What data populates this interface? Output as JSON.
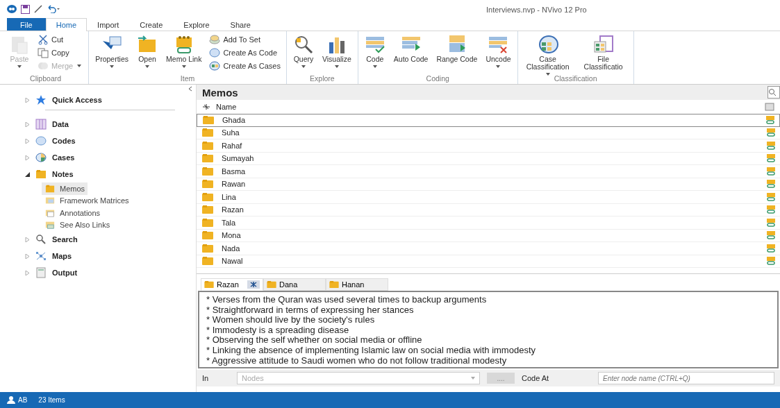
{
  "window": {
    "title": "Interviews.nvp - NVivo 12 Pro"
  },
  "ribbon_tabs": [
    {
      "label": "File",
      "kind": "file",
      "selected": false
    },
    {
      "label": "Home",
      "kind": "tab",
      "selected": true
    },
    {
      "label": "Import",
      "kind": "tab",
      "selected": false
    },
    {
      "label": "Create",
      "kind": "tab",
      "selected": false
    },
    {
      "label": "Explore",
      "kind": "tab",
      "selected": false
    },
    {
      "label": "Share",
      "kind": "tab",
      "selected": false
    }
  ],
  "ribbon_groups": [
    {
      "label": "Clipboard",
      "buttons": [
        {
          "label": "Paste",
          "kind": "large",
          "dropdown": true,
          "disabled": true
        },
        {
          "label": "Cut",
          "kind": "small",
          "dropdown": false,
          "disabled": false
        },
        {
          "label": "Copy",
          "kind": "small",
          "dropdown": false,
          "disabled": false
        },
        {
          "label": "Merge",
          "kind": "small",
          "dropdown": true,
          "disabled": true
        }
      ]
    },
    {
      "label": "Item",
      "buttons": [
        {
          "label": "Properties",
          "kind": "large",
          "dropdown": true,
          "disabled": false
        },
        {
          "label": "Open",
          "kind": "large",
          "dropdown": true,
          "disabled": false
        },
        {
          "label": "Memo Link",
          "kind": "large",
          "dropdown": true,
          "disabled": false
        },
        {
          "label": "Add To Set",
          "kind": "small",
          "dropdown": false,
          "disabled": false
        },
        {
          "label": "Create As Code",
          "kind": "small",
          "dropdown": false,
          "disabled": false
        },
        {
          "label": "Create As Cases",
          "kind": "small",
          "dropdown": false,
          "disabled": false
        }
      ]
    },
    {
      "label": "Explore",
      "buttons": [
        {
          "label": "Query",
          "kind": "large",
          "dropdown": true,
          "disabled": false
        },
        {
          "label": "Visualize",
          "kind": "large",
          "dropdown": true,
          "disabled": false
        }
      ]
    },
    {
      "label": "Coding",
      "buttons": [
        {
          "label": "Code",
          "kind": "large",
          "dropdown": true,
          "disabled": false
        },
        {
          "label": "Auto Code",
          "kind": "large",
          "dropdown": false,
          "disabled": false
        },
        {
          "label": "Range Code",
          "kind": "large",
          "dropdown": false,
          "disabled": false
        },
        {
          "label": "Uncode",
          "kind": "large",
          "dropdown": true,
          "disabled": false
        }
      ]
    },
    {
      "label": "Classification",
      "buttons": [
        {
          "label": "Case Classification",
          "kind": "large",
          "dropdown": true,
          "disabled": false
        },
        {
          "label": "File Classificatio",
          "kind": "large",
          "dropdown": false,
          "disabled": false
        }
      ]
    }
  ],
  "navigation": [
    {
      "label": "Quick Access",
      "expanded": false,
      "selected": false
    },
    {
      "label": "Data",
      "expanded": false,
      "selected": false
    },
    {
      "label": "Codes",
      "expanded": false,
      "selected": false
    },
    {
      "label": "Cases",
      "expanded": false,
      "selected": false
    },
    {
      "label": "Notes",
      "expanded": true,
      "selected": false,
      "children": [
        {
          "label": "Memos",
          "selected": true
        },
        {
          "label": "Framework Matrices",
          "selected": false
        },
        {
          "label": "Annotations",
          "selected": false
        },
        {
          "label": "See Also Links",
          "selected": false
        }
      ]
    },
    {
      "label": "Search",
      "expanded": false,
      "selected": false
    },
    {
      "label": "Maps",
      "expanded": false,
      "selected": false
    },
    {
      "label": "Output",
      "expanded": false,
      "selected": false
    }
  ],
  "list": {
    "title": "Memos",
    "columns": [
      "Name"
    ],
    "rows": [
      {
        "name": "Ghada",
        "selected": true
      },
      {
        "name": "Suha",
        "selected": false
      },
      {
        "name": "Rahaf",
        "selected": false
      },
      {
        "name": "Sumayah",
        "selected": false
      },
      {
        "name": "Basma",
        "selected": false
      },
      {
        "name": "Rawan",
        "selected": false
      },
      {
        "name": "Lina",
        "selected": false
      },
      {
        "name": "Razan",
        "selected": false
      },
      {
        "name": "Tala",
        "selected": false
      },
      {
        "name": "Mona",
        "selected": false
      },
      {
        "name": "Nada",
        "selected": false
      },
      {
        "name": "Nawal",
        "selected": false
      }
    ]
  },
  "document_tabs": [
    {
      "label": "Razan",
      "selected": true
    },
    {
      "label": "Dana",
      "selected": false
    },
    {
      "label": "Hanan",
      "selected": false
    }
  ],
  "memo_text": [
    "* Verses from the Quran was used several times to backup arguments",
    "* Straightforward in terms of expressing her stances",
    "* Women should live by the society's rules",
    "* Immodesty is a spreading disease",
    "* Observing the self whether on social media or offline",
    "* Linking the absence of implementing Islamic law on social media with immodesty",
    "* Aggressive attitude to Saudi women who do not follow traditional modesty"
  ],
  "coding_bar": {
    "in_label": "In",
    "nodes_placeholder": "Nodes",
    "browse": "....",
    "code_at": "Code At",
    "node_placeholder": "Enter node name (CTRL+Q)"
  },
  "status_bar": {
    "user": "AB",
    "items": "23 Items"
  }
}
